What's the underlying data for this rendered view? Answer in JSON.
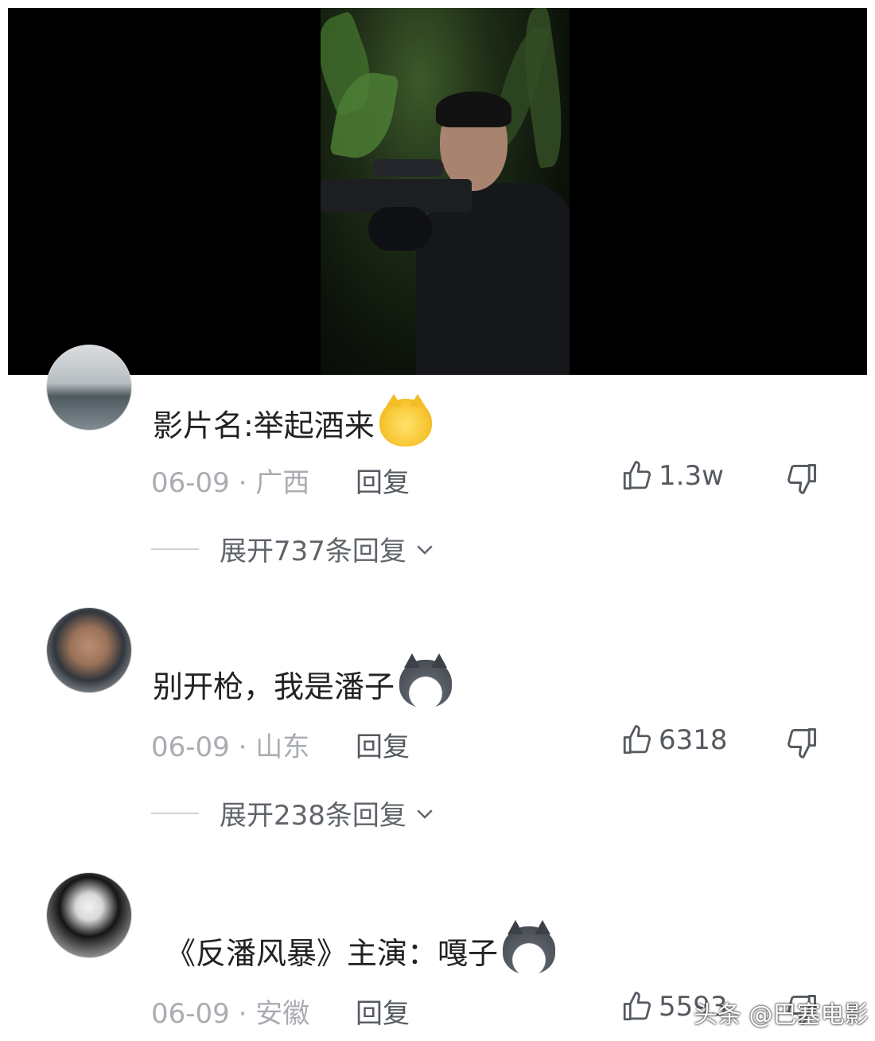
{
  "comments": [
    {
      "text": "影片名:举起酒来",
      "emoji": "thinking-cat-icon",
      "date": "06-09",
      "location": "广西",
      "reply_label": "回复",
      "likes": "1.3w",
      "expand_label": "展开737条回复"
    },
    {
      "text": "别开枪，我是潘子",
      "emoji": "husky-dog-icon",
      "date": "06-09",
      "location": "山东",
      "reply_label": "回复",
      "likes": "6318",
      "expand_label": "展开238条回复"
    },
    {
      "text": "《反潘风暴》主演：嘎子",
      "emoji": "husky-dog-icon",
      "date": "06-09",
      "location": "安徽",
      "reply_label": "回复",
      "likes": "5593"
    }
  ],
  "meta_separator": "·",
  "watermark": "头条 @巴塞电影"
}
